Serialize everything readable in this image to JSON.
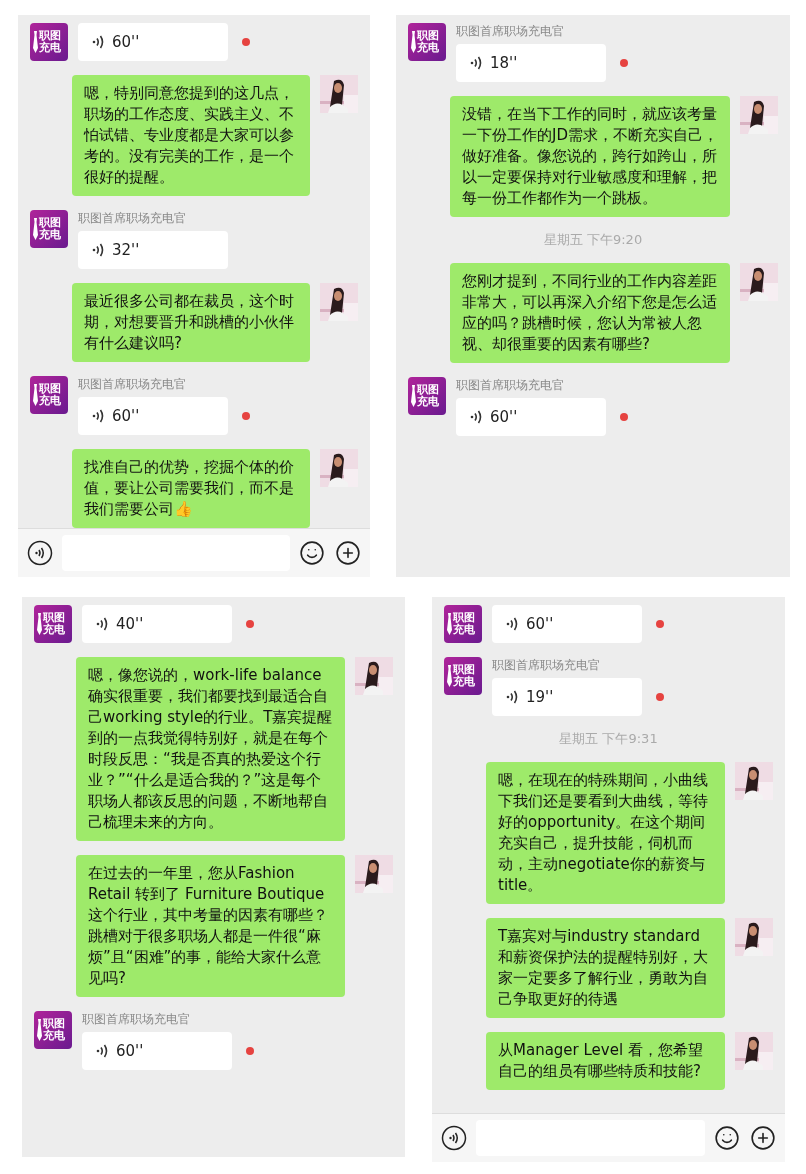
{
  "panels": [
    {
      "input_bar": true,
      "messages": [
        {
          "kind": "voice",
          "avatar": [
            "职图",
            "充电"
          ],
          "duration": "60''",
          "unread": true
        },
        {
          "kind": "text",
          "text": "嗯，特别同意您提到的这几点，职场的工作态度、实践主义、不怕试错、专业度都是大家可以参考的。没有完美的工作，是一个很好的提醒。"
        },
        {
          "kind": "voice",
          "sender": "职图首席职场充电官",
          "avatar": [
            "职图",
            "充电"
          ],
          "duration": "32''",
          "unread": false
        },
        {
          "kind": "text",
          "text": "最近很多公司都在裁员，这个时期，对想要晋升和跳槽的小伙伴有什么建议吗?"
        },
        {
          "kind": "voice",
          "sender": "职图首席职场充电官",
          "avatar": [
            "职图",
            "充电"
          ],
          "duration": "60''",
          "unread": true
        },
        {
          "kind": "text",
          "text": "找准自己的优势，挖掘个体的价值，要让公司需要我们，而不是我们需要公司👍"
        }
      ]
    },
    {
      "input_bar": false,
      "messages": [
        {
          "kind": "voice",
          "sender": "职图首席职场充电官",
          "avatar": [
            "职图",
            "充电"
          ],
          "duration": "18''",
          "unread": true
        },
        {
          "kind": "text",
          "text": "没错，在当下工作的同时，就应该考量一下份工作的JD需求，不断充实自己，做好准备。像您说的，跨行如跨山，所以一定要保持对行业敏感度和理解，把每一份工作都作为一个跳板。"
        },
        {
          "kind": "time",
          "text": "星期五 下午9:20"
        },
        {
          "kind": "text",
          "text": "您刚才提到，不同行业的工作内容差距非常大，可以再深入介绍下您是怎么适应的吗？跳槽时候，您认为常被人忽视、却很重要的因素有哪些?"
        },
        {
          "kind": "voice",
          "sender": "职图首席职场充电官",
          "avatar": [
            "职图",
            "充电"
          ],
          "duration": "60''",
          "unread": true
        }
      ]
    },
    {
      "input_bar": false,
      "messages": [
        {
          "kind": "voice",
          "avatar": [
            "职图",
            "充电"
          ],
          "duration": "40''",
          "unread": true
        },
        {
          "kind": "text",
          "text": "嗯，像您说的，work-life balance确实很重要，我们都要找到最适合自己working style的行业。T嘉宾提醒到的一点我觉得特别好，就是在每个时段反思：“我是否真的热爱这个行业？”“什么是适合我的？”这是每个职场人都该反思的问题，不断地帮自己梳理未来的方向。"
        },
        {
          "kind": "text",
          "text": "在过去的一年里，您从Fashion Retail 转到了 Furniture Boutique这个行业，其中考量的因素有哪些？跳槽对于很多职场人都是一件很“麻烦”且“困难”的事，能给大家什么意见吗?"
        },
        {
          "kind": "voice",
          "sender": "职图首席职场充电官",
          "avatar": [
            "职图",
            "充电"
          ],
          "duration": "60''",
          "unread": true
        }
      ]
    },
    {
      "input_bar": true,
      "messages": [
        {
          "kind": "voice",
          "avatar": [
            "职图",
            "充电"
          ],
          "duration": "60''",
          "unread": true
        },
        {
          "kind": "voice",
          "sender": "职图首席职场充电官",
          "avatar": [
            "职图",
            "充电"
          ],
          "duration": "19''",
          "unread": true
        },
        {
          "kind": "time",
          "text": "星期五 下午9:31"
        },
        {
          "kind": "text",
          "text": "嗯，在现在的特殊期间，小曲线下我们还是要看到大曲线，等待好的opportunity。在这个期间充实自己，提升技能，伺机而动，主动negotiate你的薪资与title。"
        },
        {
          "kind": "text",
          "text": "T嘉宾对与industry standard和薪资保护法的提醒特别好，大家一定要多了解行业，勇敢为自己争取更好的待遇"
        },
        {
          "kind": "text",
          "text": "从Manager Level 看，您希望自己的组员有哪些特质和技能?"
        }
      ]
    }
  ]
}
